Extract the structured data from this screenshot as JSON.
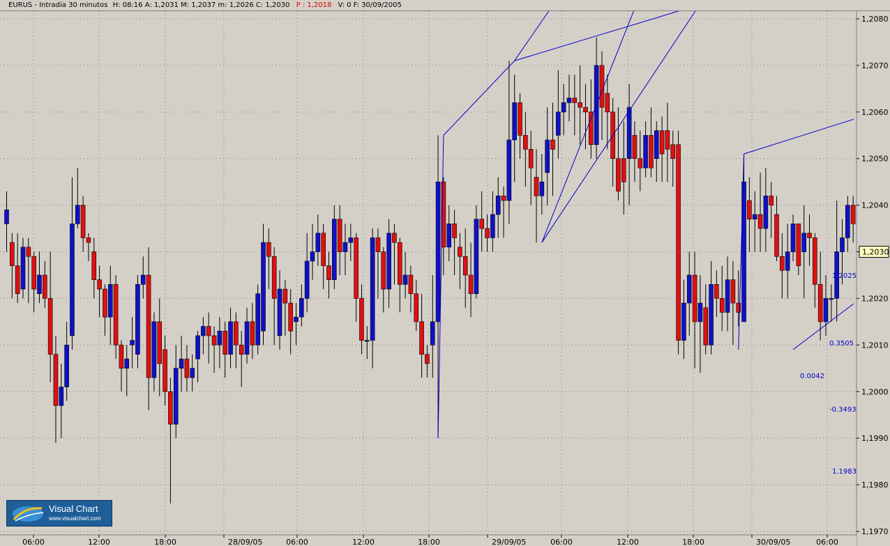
{
  "header": {
    "symbol": "EURUS - Intradía 30 minutos",
    "stats": "H: 08:16  A: 1,2031  M: 1,2037  m: 1,2026  C: 1,2030",
    "p_label": "P : 1,2018",
    "tail": "V: 0  F: 30/09/2005"
  },
  "logo": {
    "title": "Visual Chart",
    "url": "www.visualchart.com"
  },
  "colors": {
    "up": "#1010c8",
    "down": "#e01010",
    "line": "#0000c8",
    "bg": "#d4d0c8",
    "grid": "#808080"
  },
  "chart_data": {
    "type": "candlestick",
    "title": "EURUS - Intradía 30 minutos",
    "ylim": [
      1.197,
      1.208
    ],
    "y_ticks": [
      "1,2080",
      "1,2070",
      "1,2060",
      "1,2050",
      "1,2040",
      "1,2030",
      "1,2020",
      "1,2010",
      "1,2000",
      "1,1990",
      "1,1980",
      "1,1970"
    ],
    "x_ticks": [
      "06:00",
      "12:00",
      "18:00",
      "28/09/05",
      "06:00",
      "12:00",
      "18:00",
      "29/09/05",
      "06:00",
      "12:00",
      "18:00",
      "30/09/05",
      "06:00"
    ],
    "last_price": "1,2030",
    "candles": [
      [
        1.2036,
        1.2039,
        1.203,
        1.2043
      ],
      [
        1.2032,
        1.2027,
        1.202,
        1.2034
      ],
      [
        1.2027,
        1.2021,
        1.2019,
        1.2034
      ],
      [
        1.2022,
        1.2031,
        1.202,
        1.2033
      ],
      [
        1.2031,
        1.2029,
        1.2019,
        1.2033
      ],
      [
        1.2029,
        1.2022,
        1.2017,
        1.203
      ],
      [
        1.2021,
        1.2025,
        1.2019,
        1.203
      ],
      [
        1.2025,
        1.202,
        1.2018,
        1.2028
      ],
      [
        1.202,
        1.2008,
        1.2002,
        1.203
      ],
      [
        1.2008,
        1.1997,
        1.1989,
        1.2012
      ],
      [
        1.1997,
        1.2001,
        1.199,
        1.2006
      ],
      [
        1.2001,
        1.201,
        1.1998,
        1.2015
      ],
      [
        1.2012,
        1.2036,
        1.2009,
        1.2046
      ],
      [
        1.2036,
        1.204,
        1.2035,
        1.2048
      ],
      [
        1.204,
        1.2033,
        1.203,
        1.2042
      ],
      [
        1.2033,
        1.2032,
        1.2028,
        1.2034
      ],
      [
        1.203,
        1.2024,
        1.202,
        1.2033
      ],
      [
        1.2024,
        1.2022,
        1.2016,
        1.2027
      ],
      [
        1.2022,
        1.2016,
        1.2012,
        1.2023
      ],
      [
        1.2016,
        1.2023,
        1.201,
        1.2027
      ],
      [
        1.2023,
        1.201,
        1.2007,
        1.2025
      ],
      [
        1.201,
        1.2005,
        1.2,
        1.2011
      ],
      [
        1.2005,
        1.2007,
        1.1999,
        1.201
      ],
      [
        1.201,
        1.2011,
        1.2005,
        1.2016
      ],
      [
        1.2008,
        1.2023,
        1.2005,
        1.2025
      ],
      [
        1.2023,
        1.2025,
        1.202,
        1.2029
      ],
      [
        1.2025,
        1.2003,
        1.1996,
        1.2031
      ],
      [
        1.2003,
        1.2015,
        1.2,
        1.2017
      ],
      [
        1.2015,
        1.2006,
        1.1999,
        1.202
      ],
      [
        1.2009,
        1.2,
        1.1997,
        1.2012
      ],
      [
        1.2,
        1.1993,
        1.1976,
        1.2003
      ],
      [
        1.1993,
        1.2005,
        1.199,
        1.201
      ],
      [
        1.2005,
        1.2007,
        1.2,
        1.2012
      ],
      [
        1.2007,
        1.2003,
        1.2,
        1.201
      ],
      [
        1.2003,
        1.2005,
        1.2,
        1.2008
      ],
      [
        1.2007,
        1.2012,
        1.2002,
        1.2013
      ],
      [
        1.2012,
        1.2014,
        1.2008,
        1.2016
      ],
      [
        1.2014,
        1.2012,
        1.2006,
        1.2017
      ],
      [
        1.2012,
        1.201,
        1.2004,
        1.2014
      ],
      [
        1.201,
        1.2013,
        1.2005,
        1.2016
      ],
      [
        1.2013,
        1.2008,
        1.2003,
        1.2015
      ],
      [
        1.2008,
        1.2015,
        1.2005,
        1.2018
      ],
      [
        1.2015,
        1.201,
        1.2005,
        1.2017
      ],
      [
        1.201,
        1.2008,
        1.2001,
        1.2013
      ],
      [
        1.2008,
        1.2015,
        1.2006,
        1.2018
      ],
      [
        1.2015,
        1.201,
        1.2007,
        1.2019
      ],
      [
        1.201,
        1.2021,
        1.2008,
        1.2023
      ],
      [
        1.2013,
        1.2032,
        1.201,
        1.2036
      ],
      [
        1.2032,
        1.2029,
        1.2022,
        1.2035
      ],
      [
        1.2029,
        1.202,
        1.201,
        1.2031
      ],
      [
        1.2012,
        1.2022,
        1.2009,
        1.2026
      ],
      [
        1.2022,
        1.2019,
        1.2012,
        1.2024
      ],
      [
        1.2019,
        1.2013,
        1.2008,
        1.2022
      ],
      [
        1.2015,
        1.2016,
        1.201,
        1.2019
      ],
      [
        1.2016,
        1.202,
        1.2014,
        1.2023
      ],
      [
        1.202,
        1.2028,
        1.2017,
        1.2034
      ],
      [
        1.2028,
        1.203,
        1.2024,
        1.2036
      ],
      [
        1.203,
        1.2034,
        1.2027,
        1.2038
      ],
      [
        1.2034,
        1.2027,
        1.2022,
        1.2036
      ],
      [
        1.2027,
        1.2024,
        1.202,
        1.203
      ],
      [
        1.2024,
        1.2037,
        1.2022,
        1.204
      ],
      [
        1.2037,
        1.203,
        1.2025,
        1.204
      ],
      [
        1.203,
        1.2032,
        1.2025,
        1.2036
      ],
      [
        1.2032,
        1.2033,
        1.2028,
        1.2036
      ],
      [
        1.2033,
        1.202,
        1.2015,
        1.2034
      ],
      [
        1.202,
        1.2011,
        1.2008,
        1.2023
      ],
      [
        1.2011,
        1.2011,
        1.2007,
        1.2014
      ],
      [
        1.2011,
        1.2033,
        1.2005,
        1.2035
      ],
      [
        1.2033,
        1.203,
        1.202,
        1.2035
      ],
      [
        1.203,
        1.2022,
        1.2017,
        1.2031
      ],
      [
        1.2022,
        1.2034,
        1.2018,
        1.2037
      ],
      [
        1.2034,
        1.2032,
        1.2023,
        1.2036
      ],
      [
        1.2032,
        1.2023,
        1.2017,
        1.2033
      ],
      [
        1.2023,
        1.2025,
        1.202,
        1.203
      ],
      [
        1.2025,
        1.2021,
        1.2017,
        1.2027
      ],
      [
        1.2021,
        1.2015,
        1.2013,
        1.2024
      ],
      [
        1.2015,
        1.2008,
        1.2003,
        1.2021
      ],
      [
        1.2008,
        1.2006,
        1.2003,
        1.201
      ],
      [
        1.201,
        1.2015,
        1.2003,
        1.2025
      ],
      [
        1.2015,
        1.2045,
        1.199,
        1.2055
      ],
      [
        1.2045,
        1.2031,
        1.2025,
        1.2046
      ],
      [
        1.2031,
        1.2036,
        1.2028,
        1.204
      ],
      [
        1.2036,
        1.2033,
        1.2025,
        1.2039
      ],
      [
        1.2031,
        1.2029,
        1.2022,
        1.2034
      ],
      [
        1.2029,
        1.2025,
        1.2018,
        1.2035
      ],
      [
        1.2025,
        1.2021,
        1.2016,
        1.2032
      ],
      [
        1.2021,
        1.2037,
        1.202,
        1.204
      ],
      [
        1.2037,
        1.2035,
        1.203,
        1.2043
      ],
      [
        1.2035,
        1.2033,
        1.203,
        1.2038
      ],
      [
        1.2033,
        1.2038,
        1.203,
        1.2043
      ],
      [
        1.2038,
        1.2042,
        1.2033,
        1.2046
      ],
      [
        1.2042,
        1.2041,
        1.2033,
        1.2044
      ],
      [
        1.2041,
        1.2054,
        1.2036,
        1.2071
      ],
      [
        1.2054,
        1.2062,
        1.2045,
        1.2068
      ],
      [
        1.2062,
        1.2055,
        1.205,
        1.2064
      ],
      [
        1.2055,
        1.2052,
        1.2044,
        1.206
      ],
      [
        1.2052,
        1.2048,
        1.204,
        1.2056
      ],
      [
        1.2046,
        1.2042,
        1.2032,
        1.2052
      ],
      [
        1.2042,
        1.2045,
        1.2038,
        1.2051
      ],
      [
        1.2047,
        1.2054,
        1.204,
        1.2061
      ],
      [
        1.2054,
        1.2052,
        1.2042,
        1.2062
      ],
      [
        1.2055,
        1.206,
        1.205,
        1.2069
      ],
      [
        1.206,
        1.2062,
        1.2055,
        1.2066
      ],
      [
        1.2062,
        1.2063,
        1.2058,
        1.2068
      ],
      [
        1.2063,
        1.2062,
        1.2055,
        1.2068
      ],
      [
        1.2062,
        1.2061,
        1.2053,
        1.207
      ],
      [
        1.2061,
        1.206,
        1.2052,
        1.2066
      ],
      [
        1.206,
        1.2053,
        1.205,
        1.2067
      ],
      [
        1.2053,
        1.207,
        1.205,
        1.2076
      ],
      [
        1.207,
        1.2061,
        1.2054,
        1.2073
      ],
      [
        1.2064,
        1.206,
        1.2052,
        1.2068
      ],
      [
        1.206,
        1.205,
        1.2044,
        1.2063
      ],
      [
        1.205,
        1.2043,
        1.2041,
        1.2061
      ],
      [
        1.205,
        1.2045,
        1.2038,
        1.2058
      ],
      [
        1.205,
        1.2061,
        1.204,
        1.2066
      ],
      [
        1.2055,
        1.205,
        1.2045,
        1.2058
      ],
      [
        1.205,
        1.2048,
        1.2043,
        1.2056
      ],
      [
        1.2048,
        1.2055,
        1.2046,
        1.2058
      ],
      [
        1.2055,
        1.2048,
        1.2046,
        1.2061
      ],
      [
        1.205,
        1.2056,
        1.2045,
        1.2058
      ],
      [
        1.2056,
        1.2051,
        1.2045,
        1.2059
      ],
      [
        1.2056,
        1.2052,
        1.2045,
        1.2062
      ],
      [
        1.2053,
        1.205,
        1.2044,
        1.2056
      ],
      [
        1.2053,
        1.2011,
        1.2008,
        1.2056
      ],
      [
        1.2011,
        1.2019,
        1.2007,
        1.2024
      ],
      [
        1.2019,
        1.2025,
        1.2012,
        1.203
      ],
      [
        1.2025,
        1.2015,
        1.2005,
        1.203
      ],
      [
        1.2015,
        1.2019,
        1.2004,
        1.2025
      ],
      [
        1.2018,
        1.201,
        1.2008,
        1.2023
      ],
      [
        1.201,
        1.2023,
        1.2008,
        1.2028
      ],
      [
        1.2023,
        1.202,
        1.2016,
        1.2026
      ],
      [
        1.202,
        1.2017,
        1.2013,
        1.2027
      ],
      [
        1.2017,
        1.2024,
        1.2013,
        1.2029
      ],
      [
        1.2024,
        1.2019,
        1.201,
        1.2028
      ],
      [
        1.2019,
        1.2017,
        1.2014,
        1.2026
      ],
      [
        1.2015,
        1.2045,
        1.2015,
        1.2051
      ],
      [
        1.2041,
        1.2037,
        1.203,
        1.2046
      ],
      [
        1.2037,
        1.2038,
        1.203,
        1.2043
      ],
      [
        1.2038,
        1.2035,
        1.203,
        1.2047
      ],
      [
        1.2035,
        1.2042,
        1.203,
        1.2048
      ],
      [
        1.2042,
        1.204,
        1.2033,
        1.2045
      ],
      [
        1.2038,
        1.2029,
        1.2028,
        1.2042
      ],
      [
        1.2029,
        1.2026,
        1.202,
        1.2034
      ],
      [
        1.2026,
        1.203,
        1.202,
        1.2036
      ],
      [
        1.203,
        1.2036,
        1.2028,
        1.2038
      ],
      [
        1.2036,
        1.2027,
        1.2025,
        1.2036
      ],
      [
        1.203,
        1.2034,
        1.202,
        1.204
      ],
      [
        1.2034,
        1.2033,
        1.2027,
        1.2038
      ],
      [
        1.2033,
        1.2023,
        1.2018,
        1.2034
      ],
      [
        1.2023,
        1.2015,
        1.2011,
        1.203
      ],
      [
        1.2015,
        1.202,
        1.2012,
        1.2025
      ],
      [
        1.202,
        1.202,
        1.2015,
        1.2023
      ],
      [
        1.202,
        1.203,
        1.2015,
        1.2041
      ],
      [
        1.203,
        1.2033,
        1.2023,
        1.2037
      ],
      [
        1.2033,
        1.204,
        1.203,
        1.2042
      ],
      [
        1.204,
        1.2036,
        1.2032,
        1.2042
      ],
      [
        1.2036,
        1.2039,
        1.203,
        1.2057
      ],
      [
        1.2039,
        1.2045,
        1.2031,
        1.205
      ],
      [
        1.2045,
        1.204,
        1.2039,
        1.2049
      ],
      [
        1.204,
        1.2047,
        1.2038,
        1.205
      ],
      [
        1.2047,
        1.2043,
        1.2037,
        1.2052
      ],
      [
        1.2043,
        1.2049,
        1.2039,
        1.2051
      ],
      [
        1.2049,
        1.2046,
        1.204,
        1.205
      ],
      [
        1.2045,
        1.204,
        1.2038,
        1.2051
      ],
      [
        1.2039,
        1.2041,
        1.2032,
        1.2054
      ],
      [
        1.2047,
        1.204,
        1.2038,
        1.2051
      ],
      [
        1.204,
        1.2035,
        1.203,
        1.2049
      ],
      [
        1.2035,
        1.2033,
        1.2028,
        1.2039
      ],
      [
        1.2031,
        1.203,
        1.2026,
        1.2037
      ]
    ],
    "trendlines": [
      {
        "from": [
          79,
          1.199
        ],
        "to": [
          80,
          1.2055
        ]
      },
      {
        "from": [
          80,
          1.2055
        ],
        "to": [
          93,
          1.2071
        ]
      },
      {
        "from": [
          93,
          1.2071
        ],
        "to": [
          103,
          1.2088
        ]
      },
      {
        "from": [
          93,
          1.2071
        ],
        "to": [
          124,
          1.2082
        ]
      },
      {
        "from": [
          98,
          1.2032
        ],
        "to": [
          120,
          1.2097
        ]
      },
      {
        "from": [
          98,
          1.2032
        ],
        "to": [
          128,
          1.2085
        ]
      },
      {
        "from": [
          134,
          1.2009
        ],
        "to": [
          135,
          1.2051
        ]
      },
      {
        "from": [
          135,
          1.2051
        ],
        "to": [
          162,
          1.2061
        ]
      },
      {
        "from": [
          144,
          1.2009
        ],
        "to": [
          162,
          1.2025
        ]
      }
    ],
    "measure": {
      "top_label": "1.2025",
      "bottom_label": "1.1983",
      "diff_label": "0.0042",
      "pct_up_label": "0.3505",
      "pct_down_label": "-0.3493",
      "x_index": 156,
      "top": 1.2025,
      "bottom": 1.1983
    }
  }
}
